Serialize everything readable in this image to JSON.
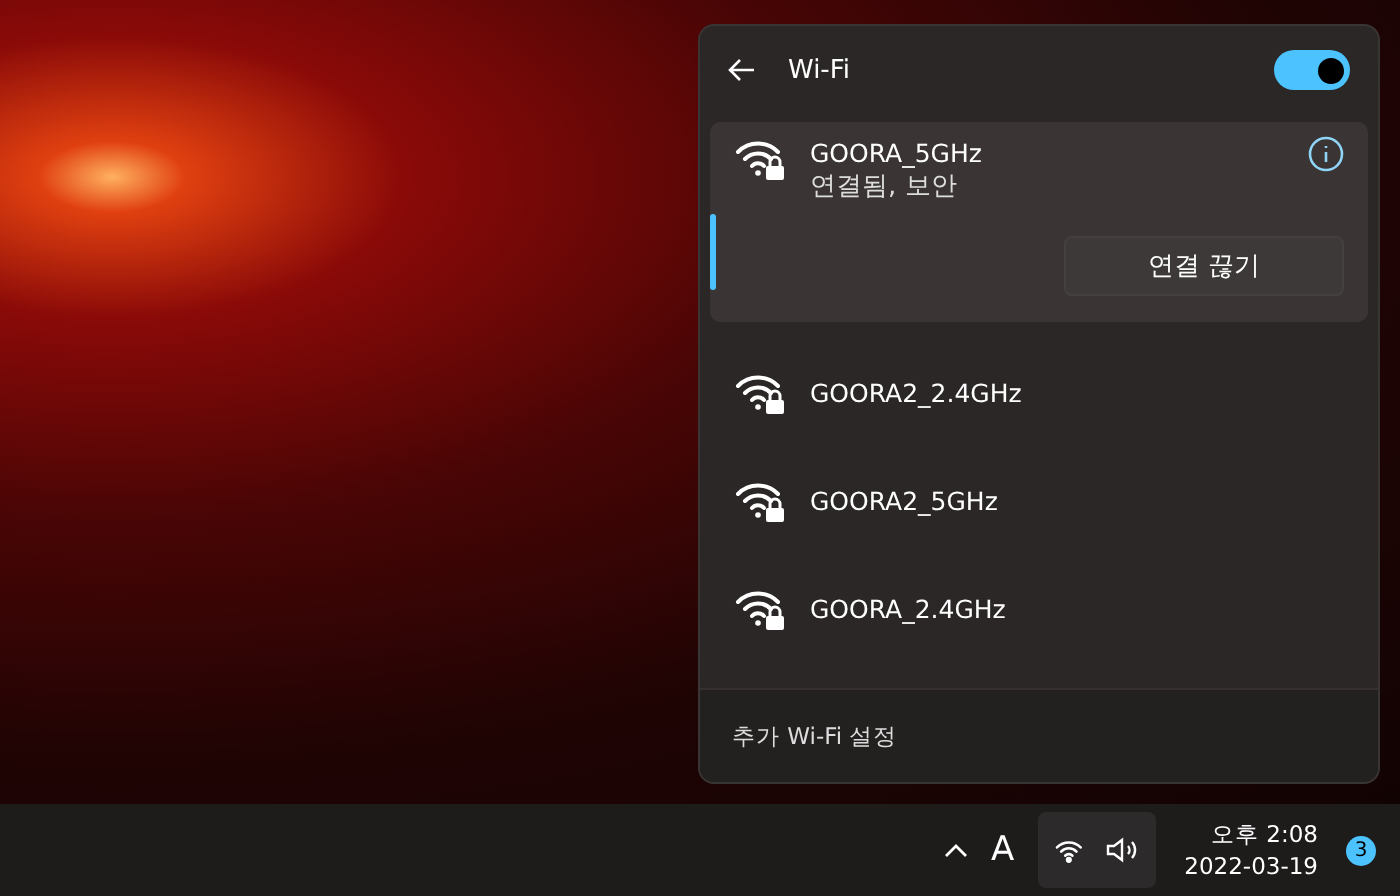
{
  "panel": {
    "title": "Wi-Fi",
    "wifi_on": true,
    "connected": {
      "name": "GOORA_5GHz",
      "status": "연결됨, 보안",
      "button": "연결 끊기",
      "selected": true
    },
    "networks": [
      {
        "name": "GOORA2_2.4GHz",
        "secured": true
      },
      {
        "name": "GOORA2_5GHz",
        "secured": true
      },
      {
        "name": "GOORA_2.4GHz",
        "secured": true
      }
    ],
    "more_settings": "추가 Wi-Fi 설정"
  },
  "taskbar": {
    "ime": "A",
    "time": "오후 2:08",
    "date": "2022-03-19",
    "notifications": "3"
  }
}
